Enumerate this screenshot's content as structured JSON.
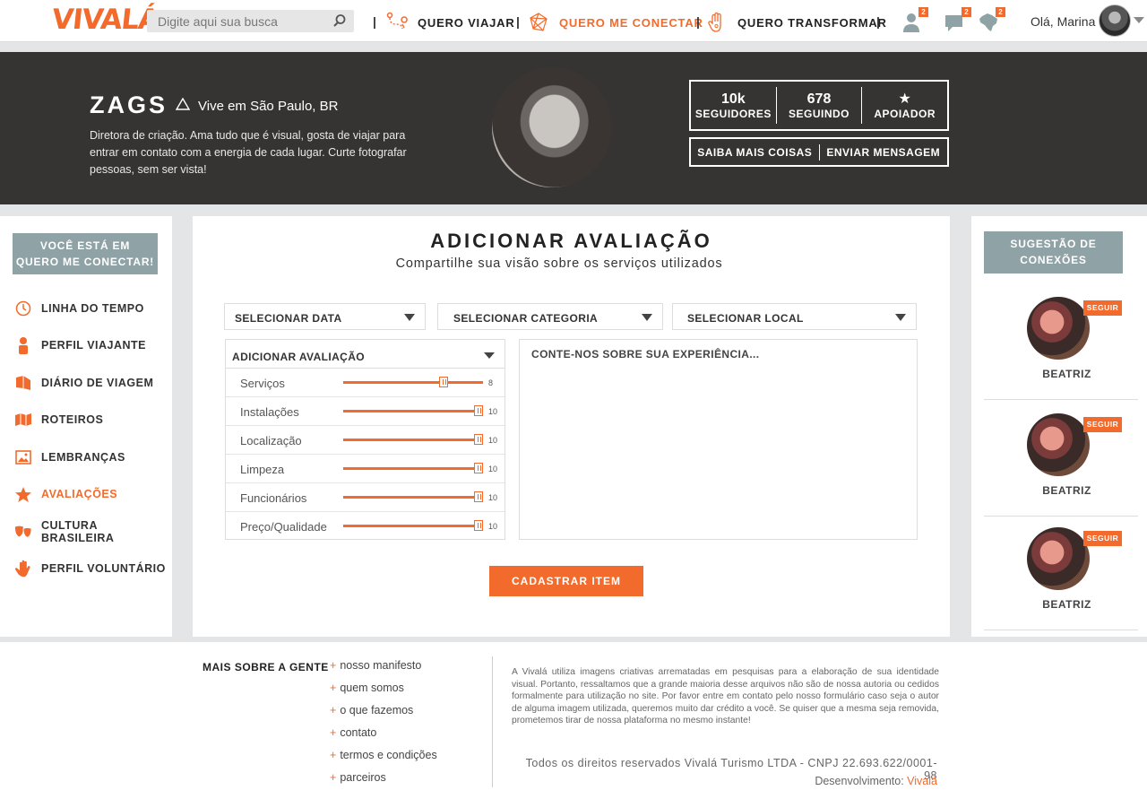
{
  "topnav": {
    "logo": "VIVALÁ",
    "search_placeholder": "Digite aqui sua busca",
    "items": [
      {
        "label": "QUERO VIAJAR",
        "icon": "route-pin-icon"
      },
      {
        "label": "QUERO ME CONECTAR",
        "icon": "network-icon",
        "active": true
      },
      {
        "label": "QUERO TRANSFORMAR",
        "icon": "hand-icon"
      }
    ],
    "notifications": [
      {
        "icon": "user-icon",
        "count": "2"
      },
      {
        "icon": "chat-icon",
        "count": "2"
      },
      {
        "icon": "brazil-map-icon",
        "count": "2"
      }
    ],
    "greeting": "Olá, Marina"
  },
  "profile": {
    "name": "ZAGS",
    "location": "Vive em São Paulo, BR",
    "bio": "Diretora de criação. Ama tudo que é visual, gosta de viajar para entrar em contato com a energia de cada lugar. Curte fotografar pessoas, sem ser vista!",
    "stats": [
      {
        "value": "10k",
        "label": "SEGUIDORES"
      },
      {
        "value": "678",
        "label": "SEGUINDO"
      },
      {
        "value": "★",
        "label": "APOIADOR"
      }
    ],
    "actions": [
      "SAIBA MAIS COISAS",
      "ENVIAR MENSAGEM"
    ]
  },
  "sidebar": {
    "you_are_line1": "VOCÊ ESTÁ EM",
    "you_are_line2": "QUERO ME CONECTAR!",
    "items": [
      {
        "label": "LINHA DO TEMPO",
        "icon": "clock-icon"
      },
      {
        "label": "PERFIL VIAJANTE",
        "icon": "person-icon"
      },
      {
        "label": "DIÁRIO DE VIAGEM",
        "icon": "book-icon"
      },
      {
        "label": "ROTEIROS",
        "icon": "map-icon"
      },
      {
        "label": "LEMBRANÇAS",
        "icon": "picture-icon"
      },
      {
        "label": "AVALIAÇÕES",
        "icon": "star-icon",
        "active": true
      },
      {
        "label": "CULTURA BRASILEIRA",
        "icon": "theater-masks-icon"
      },
      {
        "label": "PERFIL VOLUNTÁRIO",
        "icon": "helping-hand-icon"
      }
    ]
  },
  "main": {
    "title": "ADICIONAR AVALIAÇÃO",
    "subtitle": "Compartilhe sua visão sobre os serviços utilizados",
    "selects": [
      "SELECIONAR DATA",
      "SELECIONAR CATEGORIA",
      "SELECIONAR LOCAL"
    ],
    "rating_header": "ADICIONAR AVALIAÇÃO",
    "ratings": [
      {
        "label": "Serviços",
        "value": 8,
        "max": 10
      },
      {
        "label": "Instalações",
        "value": 10,
        "max": 10
      },
      {
        "label": "Localização",
        "value": 10,
        "max": 10
      },
      {
        "label": "Limpeza",
        "value": 10,
        "max": 10
      },
      {
        "label": "Funcionários",
        "value": 10,
        "max": 10
      },
      {
        "label": "Preço/Qualidade",
        "value": 10,
        "max": 10
      }
    ],
    "textarea_placeholder": "CONTE-NOS SOBRE SUA EXPERIÊNCIA...",
    "submit_label": "CADASTRAR ITEM"
  },
  "suggestions": {
    "title_line1": "SUGESTÃO DE",
    "title_line2": "CONEXÕES",
    "people": [
      {
        "name": "BEATRIZ",
        "follow": "SEGUIR"
      },
      {
        "name": "BEATRIZ",
        "follow": "SEGUIR"
      },
      {
        "name": "BEATRIZ",
        "follow": "SEGUIR"
      }
    ]
  },
  "footer": {
    "heading": "MAIS SOBRE A GENTE",
    "links": [
      "nosso manifesto",
      "quem somos",
      "o que fazemos",
      "contato",
      "termos e condições",
      "parceiros"
    ],
    "note": "A Vivalá utiliza imagens criativas arrematadas em pesquisas para a elaboração de sua identidade visual. Portanto, ressaltamos que a grande maioria desse arquivos não são de nossa autoria ou cedidos formalmente para utilização no site. Por favor entre em contato pelo nosso formulário caso seja o autor de alguma imagem utilizada, queremos muito dar crédito a você. Se quiser que a mesma seja removida, prometemos tirar de nossa plataforma no mesmo instante!",
    "copyright": "Todos os direitos reservados Vivalá Turismo LTDA   -  CNPJ 22.693.622/0001-98",
    "dev_label": "Desenvolvimento:",
    "dev_brand": "Vivalá"
  },
  "colors": {
    "accent": "#f26b2c",
    "banner": "#353433",
    "label_box": "#8fa2a6"
  }
}
